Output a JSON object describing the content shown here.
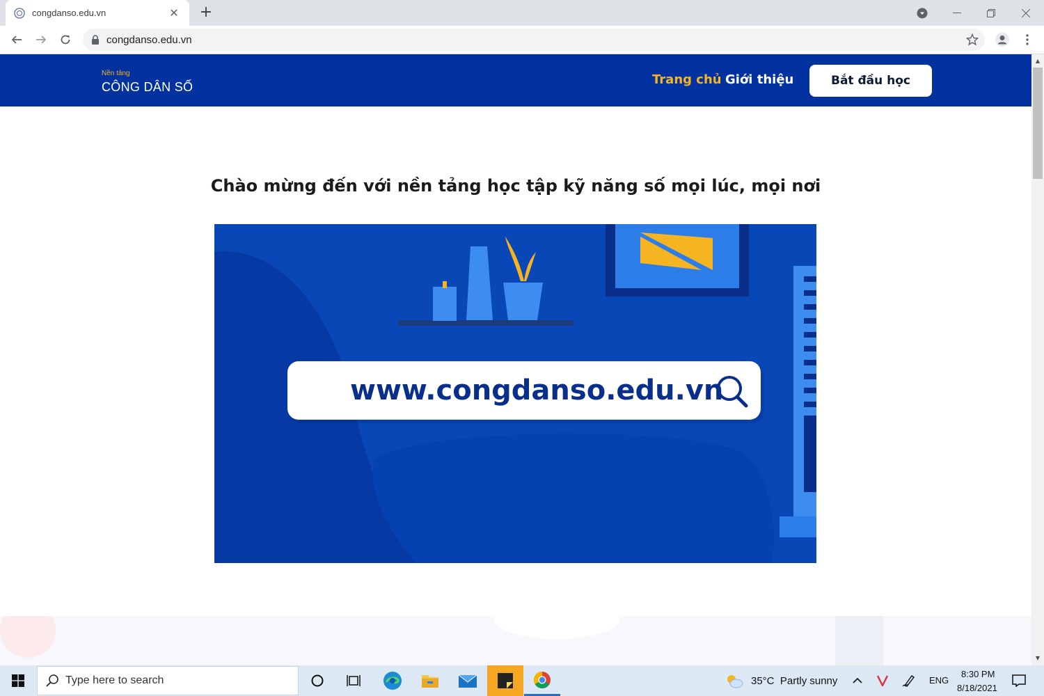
{
  "browser": {
    "tab_title": "congdanso.edu.vn",
    "url": "congdanso.edu.vn"
  },
  "site": {
    "logo_small": "Nền tảng",
    "logo_big": "CÔNG DÂN SỐ",
    "nav": {
      "home": "Trang chủ",
      "about": "Giới thiệu"
    },
    "cta_label": "Bắt đầu học",
    "welcome_heading": "Chào mừng đến với nền tảng học tập kỹ năng số mọi lúc, mọi nơi",
    "hero_search_text": "www.congdanso.edu.vn"
  },
  "taskbar": {
    "search_placeholder": "Type here to search",
    "weather": "35°C  Partly sunny",
    "language": "ENG",
    "time": "8:30 PM",
    "date": "8/18/2021"
  },
  "colors": {
    "brand_blue": "#0231a0",
    "accent_yellow": "#f5b522"
  }
}
